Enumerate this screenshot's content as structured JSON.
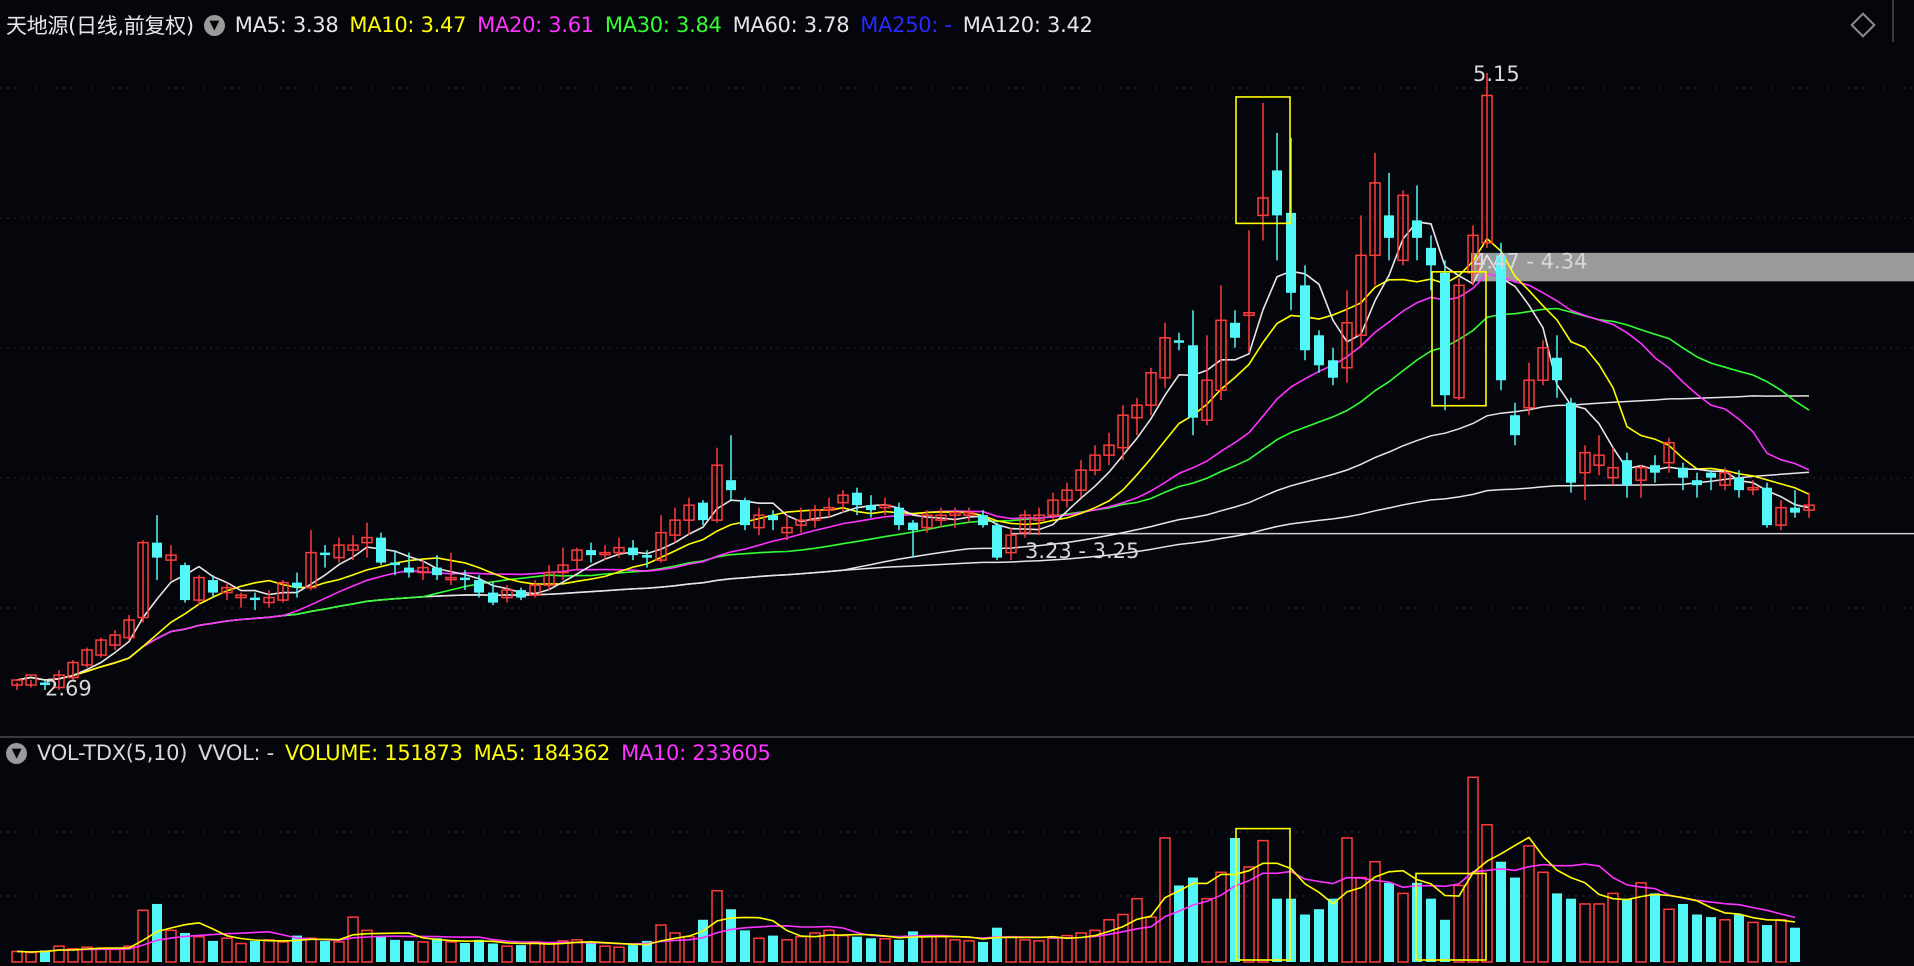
{
  "title": "天地源(日线,前复权)",
  "ma_legend": [
    {
      "label": "MA5: 3.38",
      "color": "#e6e6e6"
    },
    {
      "label": "MA10: 3.47",
      "color": "#ffff00"
    },
    {
      "label": "MA20: 3.61",
      "color": "#ff33ff"
    },
    {
      "label": "MA30: 3.84",
      "color": "#33ff33"
    },
    {
      "label": "MA60: 3.78",
      "color": "#e6e6e6"
    },
    {
      "label": "MA250: -",
      "color": "#2a2aff"
    },
    {
      "label": "MA120: 3.42",
      "color": "#e6e6e6"
    }
  ],
  "vol_legend": [
    {
      "label": "VOL-TDX(5,10)",
      "color": "#d8d8d8"
    },
    {
      "label": "VVOL: -",
      "color": "#d8d8d8"
    },
    {
      "label": "VOLUME: 151873",
      "color": "#ffff00"
    },
    {
      "label": "MA5: 184362",
      "color": "#ffff00"
    },
    {
      "label": "MA10: 233605",
      "color": "#ff33ff"
    }
  ],
  "icons": {
    "collapse": "chevron-down-icon",
    "settings": "diamond-icon"
  },
  "colors": {
    "up": "#ff3c3c",
    "down": "#54f7f7",
    "ma5": "#e6e6e6",
    "ma10": "#ffff00",
    "ma20": "#ff33ff",
    "ma30": "#33ff33",
    "ma60": "#e6e6e6",
    "ma120": "#e6e6e6",
    "highlight": "#ffff00",
    "zone": "#9a9a9a"
  },
  "chart_data": [
    {
      "type": "candlestick",
      "ylim": [
        2.6,
        5.25
      ],
      "candles": [
        [
          2.7,
          2.72,
          2.68,
          2.71
        ],
        [
          2.7,
          2.74,
          2.69,
          2.72
        ],
        [
          2.71,
          2.7,
          2.68,
          2.72
        ],
        [
          2.69,
          2.74,
          2.68,
          2.76
        ],
        [
          2.73,
          2.79,
          2.72,
          2.8
        ],
        [
          2.78,
          2.84,
          2.77,
          2.85
        ],
        [
          2.82,
          2.88,
          2.81,
          2.89
        ],
        [
          2.86,
          2.9,
          2.84,
          2.92
        ],
        [
          2.89,
          2.96,
          2.88,
          2.98
        ],
        [
          2.97,
          3.27,
          2.95,
          3.28
        ],
        [
          3.27,
          3.21,
          3.12,
          3.38
        ],
        [
          3.2,
          3.22,
          3.12,
          3.26
        ],
        [
          3.18,
          3.04,
          3.03,
          3.19
        ],
        [
          3.04,
          3.13,
          3.02,
          3.14
        ],
        [
          3.12,
          3.07,
          3.05,
          3.14
        ],
        [
          3.07,
          3.09,
          3.04,
          3.11
        ],
        [
          3.05,
          3.06,
          3.01,
          3.07
        ],
        [
          3.05,
          3.04,
          3.0,
          3.07
        ],
        [
          3.03,
          3.05,
          3.01,
          3.08
        ],
        [
          3.04,
          3.11,
          3.03,
          3.12
        ],
        [
          3.11,
          3.09,
          3.05,
          3.15
        ],
        [
          3.09,
          3.23,
          3.08,
          3.32
        ],
        [
          3.23,
          3.22,
          3.17,
          3.26
        ],
        [
          3.21,
          3.26,
          3.19,
          3.29
        ],
        [
          3.24,
          3.26,
          3.2,
          3.3
        ],
        [
          3.27,
          3.29,
          3.21,
          3.35
        ],
        [
          3.29,
          3.19,
          3.18,
          3.31
        ],
        [
          3.19,
          3.18,
          3.14,
          3.24
        ],
        [
          3.17,
          3.15,
          3.13,
          3.23
        ],
        [
          3.15,
          3.17,
          3.12,
          3.2
        ],
        [
          3.17,
          3.14,
          3.12,
          3.22
        ],
        [
          3.13,
          3.13,
          3.1,
          3.23
        ],
        [
          3.13,
          3.12,
          3.08,
          3.16
        ],
        [
          3.12,
          3.07,
          3.05,
          3.14
        ],
        [
          3.07,
          3.03,
          3.02,
          3.11
        ],
        [
          3.05,
          3.08,
          3.03,
          3.1
        ],
        [
          3.08,
          3.05,
          3.04,
          3.09
        ],
        [
          3.06,
          3.1,
          3.05,
          3.12
        ],
        [
          3.1,
          3.15,
          3.08,
          3.18
        ],
        [
          3.15,
          3.18,
          3.12,
          3.25
        ],
        [
          3.2,
          3.24,
          3.16,
          3.25
        ],
        [
          3.24,
          3.22,
          3.19,
          3.27
        ],
        [
          3.23,
          3.23,
          3.2,
          3.26
        ],
        [
          3.23,
          3.25,
          3.21,
          3.29
        ],
        [
          3.25,
          3.22,
          3.2,
          3.28
        ],
        [
          3.22,
          3.21,
          3.17,
          3.24
        ],
        [
          3.2,
          3.31,
          3.19,
          3.38
        ],
        [
          3.3,
          3.36,
          3.27,
          3.41
        ],
        [
          3.36,
          3.42,
          3.3,
          3.45
        ],
        [
          3.43,
          3.36,
          3.34,
          3.44
        ],
        [
          3.36,
          3.58,
          3.35,
          3.65
        ],
        [
          3.52,
          3.48,
          3.44,
          3.7
        ],
        [
          3.44,
          3.34,
          3.32,
          3.45
        ],
        [
          3.33,
          3.38,
          3.3,
          3.41
        ],
        [
          3.38,
          3.36,
          3.32,
          3.4
        ],
        [
          3.31,
          3.33,
          3.28,
          3.38
        ],
        [
          3.34,
          3.36,
          3.31,
          3.41
        ],
        [
          3.36,
          3.4,
          3.33,
          3.42
        ],
        [
          3.4,
          3.41,
          3.37,
          3.45
        ],
        [
          3.43,
          3.46,
          3.39,
          3.48
        ],
        [
          3.47,
          3.42,
          3.38,
          3.49
        ],
        [
          3.42,
          3.4,
          3.37,
          3.46
        ],
        [
          3.41,
          3.42,
          3.38,
          3.45
        ],
        [
          3.41,
          3.34,
          3.32,
          3.43
        ],
        [
          3.35,
          3.32,
          3.21,
          3.36
        ],
        [
          3.33,
          3.38,
          3.31,
          3.4
        ],
        [
          3.36,
          3.38,
          3.33,
          3.41
        ],
        [
          3.38,
          3.39,
          3.33,
          3.41
        ],
        [
          3.38,
          3.39,
          3.35,
          3.41
        ],
        [
          3.38,
          3.34,
          3.33,
          3.4
        ],
        [
          3.34,
          3.21,
          3.2,
          3.35
        ],
        [
          3.23,
          3.3,
          3.2,
          3.33
        ],
        [
          3.31,
          3.38,
          3.29,
          3.4
        ],
        [
          3.36,
          3.38,
          3.3,
          3.41
        ],
        [
          3.38,
          3.44,
          3.36,
          3.47
        ],
        [
          3.44,
          3.48,
          3.41,
          3.51
        ],
        [
          3.48,
          3.56,
          3.45,
          3.6
        ],
        [
          3.56,
          3.62,
          3.54,
          3.66
        ],
        [
          3.62,
          3.66,
          3.58,
          3.71
        ],
        [
          3.65,
          3.78,
          3.6,
          3.82
        ],
        [
          3.77,
          3.82,
          3.7,
          3.85
        ],
        [
          3.82,
          3.95,
          3.78,
          3.97
        ],
        [
          3.93,
          4.09,
          3.89,
          4.15
        ],
        [
          4.08,
          4.07,
          4.04,
          4.11
        ],
        [
          4.06,
          3.77,
          3.7,
          4.2
        ],
        [
          3.76,
          3.92,
          3.74,
          4.1
        ],
        [
          3.88,
          4.16,
          3.84,
          4.3
        ],
        [
          4.15,
          4.09,
          4.05,
          4.2
        ],
        [
          4.18,
          4.19,
          4.03,
          4.52
        ],
        [
          4.58,
          4.65,
          4.48,
          5.03
        ],
        [
          4.76,
          4.58,
          4.4,
          4.91
        ],
        [
          4.59,
          4.27,
          4.2,
          4.89
        ],
        [
          4.3,
          4.04,
          4.0,
          4.38
        ],
        [
          4.1,
          3.98,
          3.95,
          4.12
        ],
        [
          4.0,
          3.93,
          3.9,
          4.05
        ],
        [
          3.97,
          4.15,
          3.91,
          4.28
        ],
        [
          4.1,
          4.42,
          4.05,
          4.58
        ],
        [
          4.42,
          4.71,
          4.3,
          4.83
        ],
        [
          4.58,
          4.49,
          4.4,
          4.75
        ],
        [
          4.4,
          4.66,
          4.38,
          4.68
        ],
        [
          4.56,
          4.49,
          4.4,
          4.7
        ],
        [
          4.45,
          4.38,
          4.28,
          4.5
        ],
        [
          4.35,
          3.86,
          3.8,
          4.4
        ],
        [
          3.85,
          4.3,
          3.84,
          4.33
        ],
        [
          4.35,
          4.5,
          4.3,
          4.54
        ],
        [
          4.47,
          5.06,
          4.45,
          5.15
        ],
        [
          4.42,
          3.92,
          3.88,
          4.47
        ],
        [
          3.78,
          3.7,
          3.66,
          3.83
        ],
        [
          3.81,
          3.92,
          3.78,
          3.99
        ],
        [
          3.92,
          4.05,
          3.9,
          4.08
        ],
        [
          4.01,
          3.92,
          3.85,
          4.1
        ],
        [
          3.83,
          3.51,
          3.47,
          3.85
        ],
        [
          3.55,
          3.63,
          3.44,
          3.66
        ],
        [
          3.58,
          3.62,
          3.54,
          3.7
        ],
        [
          3.53,
          3.57,
          3.5,
          3.65
        ],
        [
          3.6,
          3.5,
          3.45,
          3.63
        ],
        [
          3.52,
          3.57,
          3.45,
          3.58
        ],
        [
          3.58,
          3.55,
          3.51,
          3.62
        ],
        [
          3.59,
          3.67,
          3.55,
          3.69
        ],
        [
          3.57,
          3.53,
          3.48,
          3.59
        ],
        [
          3.52,
          3.5,
          3.45,
          3.55
        ],
        [
          3.55,
          3.53,
          3.48,
          3.56
        ],
        [
          3.5,
          3.55,
          3.48,
          3.57
        ],
        [
          3.53,
          3.48,
          3.45,
          3.56
        ],
        [
          3.49,
          3.49,
          3.46,
          3.52
        ],
        [
          3.49,
          3.34,
          3.33,
          3.51
        ],
        [
          3.34,
          3.41,
          3.32,
          3.44
        ],
        [
          3.41,
          3.39,
          3.37,
          3.48
        ],
        [
          3.4,
          3.42,
          3.37,
          3.47
        ]
      ],
      "annotations": [
        {
          "label": "2.69",
          "x": 1,
          "y": 2.69
        },
        {
          "label": "3.23 - 3.25",
          "x": 71,
          "y": 3.24
        },
        {
          "label": "5.15",
          "x": 103,
          "y": 5.15
        },
        {
          "label": "4.47 - 4.34",
          "x": 103,
          "y": 4.4
        }
      ],
      "resistance_zone": [
        4.34,
        4.47
      ],
      "support_level": 3.33,
      "highlight_candles": [
        89,
        103
      ]
    },
    {
      "type": "bar",
      "volume": [
        20,
        18,
        22,
        30,
        25,
        28,
        26,
        24,
        30,
        98,
        110,
        60,
        55,
        48,
        40,
        45,
        35,
        40,
        42,
        38,
        50,
        45,
        40,
        38,
        85,
        60,
        48,
        42,
        40,
        38,
        45,
        38,
        36,
        42,
        35,
        30,
        32,
        38,
        35,
        40,
        42,
        36,
        30,
        28,
        32,
        40,
        70,
        55,
        48,
        80,
        135,
        100,
        60,
        45,
        50,
        42,
        48,
        55,
        60,
        50,
        48,
        45,
        44,
        42,
        58,
        50,
        48,
        42,
        40,
        38,
        65,
        48,
        42,
        40,
        45,
        50,
        55,
        60,
        80,
        90,
        120,
        85,
        235,
        145,
        160,
        120,
        170,
        235,
        180,
        230,
        120,
        120,
        90,
        100,
        120,
        235,
        160,
        190,
        150,
        130,
        150,
        120,
        80,
        145,
        350,
        260,
        190,
        160,
        220,
        170,
        130,
        120,
        110,
        110,
        130,
        120,
        150,
        130,
        100,
        110,
        90,
        85,
        80,
        90,
        75,
        70,
        80,
        65
      ]
    }
  ]
}
